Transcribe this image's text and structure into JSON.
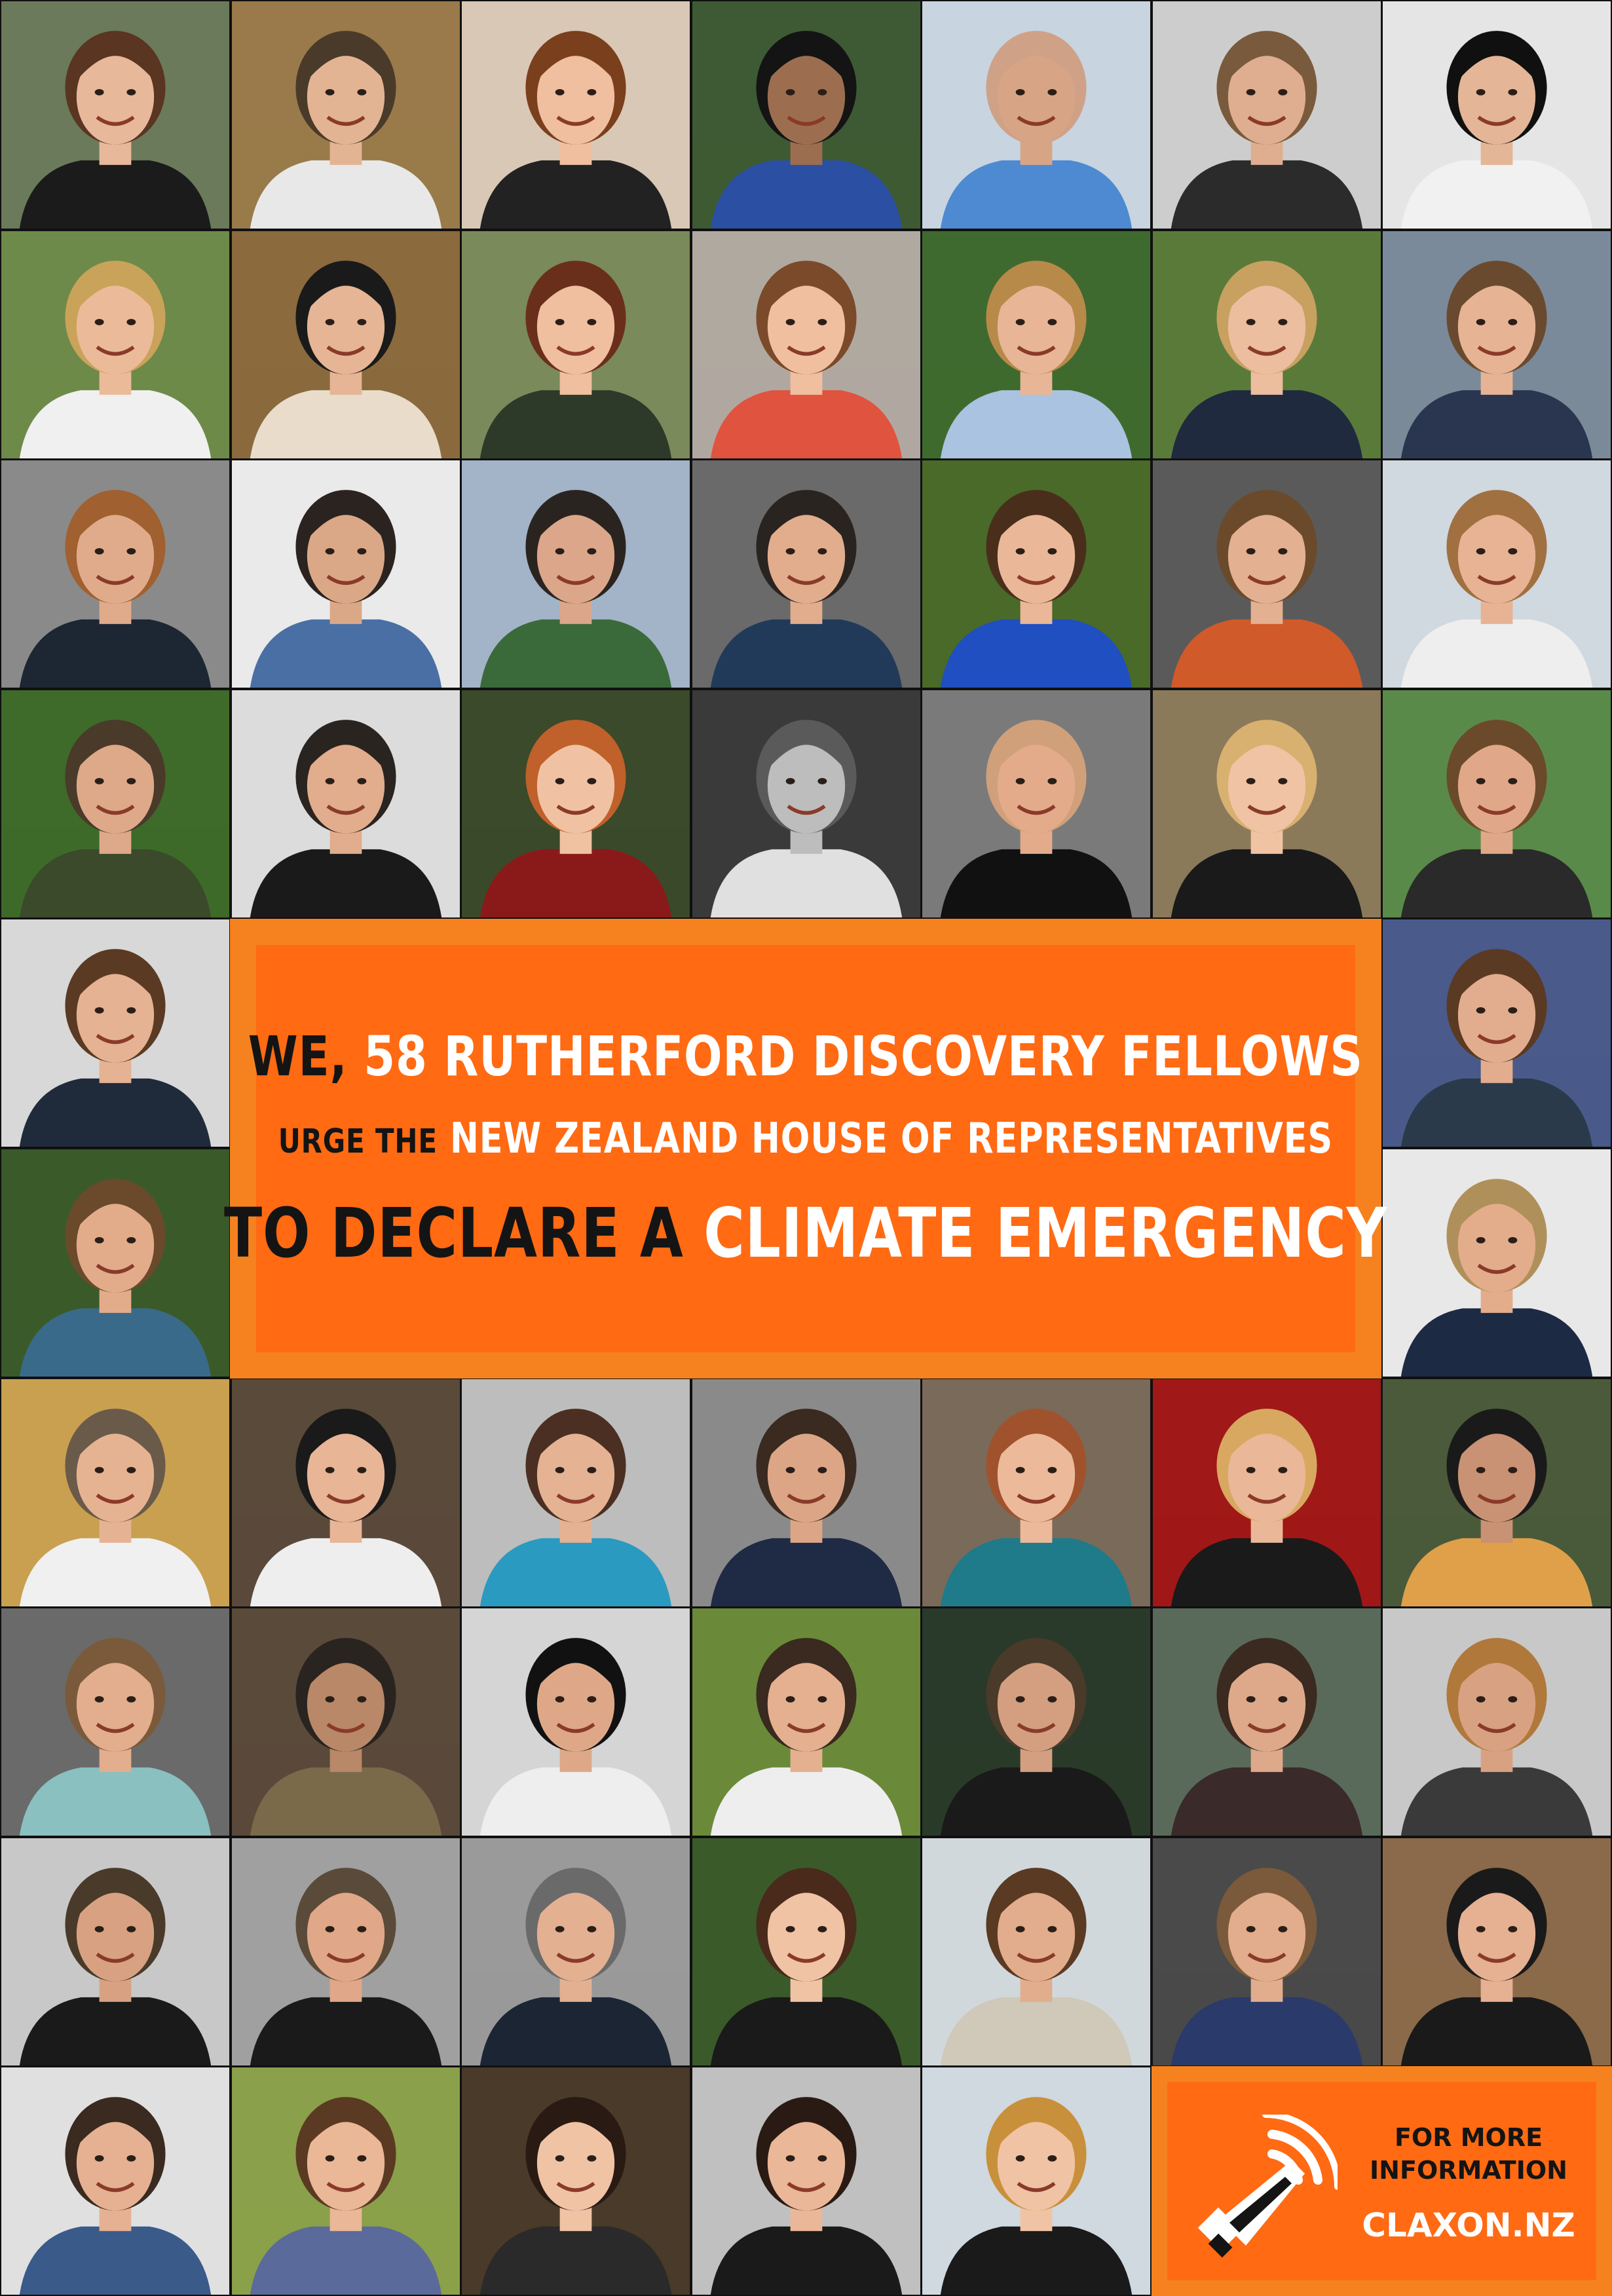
{
  "banner": {
    "line1": {
      "dark": "We,",
      "light": "58 Rutherford Discovery Fellows"
    },
    "line2": {
      "dark": "urge the",
      "light": "New Zealand House of Representatives"
    },
    "line3": {
      "dark": "to declare a",
      "light": "Climate Emergency"
    }
  },
  "info": {
    "line1": "FOR MORE",
    "line2": "INFORMATION",
    "url": "CLAXON.NZ",
    "icon": "megaphone-icon"
  },
  "portraits": [
    {
      "bg": "#6b7a5a",
      "skin": "#e8b89a",
      "hair": "#5a3522",
      "shirt": "#1b1b1b"
    },
    {
      "bg": "#9a7a4a",
      "skin": "#e3b493",
      "hair": "#4a3a2a",
      "shirt": "#e8e8e8"
    },
    {
      "bg": "#d9c8b5",
      "skin": "#efbf9f",
      "hair": "#7a3f1c",
      "shirt": "#222222"
    },
    {
      "bg": "#3e5a34",
      "skin": "#9c6e4f",
      "hair": "#141414",
      "shirt": "#2b4fa3"
    },
    {
      "bg": "#c8d4e0",
      "skin": "#d7a585",
      "hair": "#cfa287",
      "shirt": "#4d8ad1"
    },
    {
      "bg": "#cdcdcd",
      "skin": "#dfad8f",
      "hair": "#7a5a3c",
      "shirt": "#2b2b2b"
    },
    {
      "bg": "#e5e5e5",
      "skin": "#e4b596",
      "hair": "#101010",
      "shirt": "#f1f1f1"
    },
    {
      "bg": "#6e8a4a",
      "skin": "#ebbb99",
      "hair": "#c9a35a",
      "shirt": "#f0f0f0"
    },
    {
      "bg": "#8b6a3e",
      "skin": "#e6b595",
      "hair": "#1a1a1a",
      "shirt": "#e9dccb"
    },
    {
      "bg": "#7a8a5a",
      "skin": "#efbf9f",
      "hair": "#6a2f1a",
      "shirt": "#2d3a2a"
    },
    {
      "bg": "#b0a9a0",
      "skin": "#efbfa0",
      "hair": "#7a4a2a",
      "shirt": "#e0533f"
    },
    {
      "bg": "#3f6a2f",
      "skin": "#e8b696",
      "hair": "#b88a4a",
      "shirt": "#a9c3e0"
    },
    {
      "bg": "#5a7a3a",
      "skin": "#ecbd9e",
      "hair": "#c8a060",
      "shirt": "#1f2a3f"
    },
    {
      "bg": "#7a8a9a",
      "skin": "#e6b494",
      "hair": "#6a4a2f",
      "shirt": "#2a3550"
    },
    {
      "bg": "#8a8a8a",
      "skin": "#e0ab8b",
      "hair": "#a0602f",
      "shirt": "#1d2633"
    },
    {
      "bg": "#eaeaea",
      "skin": "#dba887",
      "hair": "#2a2320",
      "shirt": "#4a6fa5"
    },
    {
      "bg": "#a3b3c8",
      "skin": "#dca68a",
      "hair": "#2a2420",
      "shirt": "#3a6a3a"
    },
    {
      "bg": "#6a6a6a",
      "skin": "#e2ad8d",
      "hair": "#2a2420",
      "shirt": "#223a5a"
    },
    {
      "bg": "#4a6a2a",
      "skin": "#eab898",
      "hair": "#4a2e1c",
      "shirt": "#1f4fc0"
    },
    {
      "bg": "#5a5a5a",
      "skin": "#e3b091",
      "hair": "#6a4a2a",
      "shirt": "#d05a2a"
    },
    {
      "bg": "#d0d8e0",
      "skin": "#e7b394",
      "hair": "#a07040",
      "shirt": "#eeeeee"
    },
    {
      "bg": "#3e6a2a",
      "skin": "#dea989",
      "hair": "#4a3a2a",
      "shirt": "#3a4a2a"
    },
    {
      "bg": "#dcdcdc",
      "skin": "#e1ad8d",
      "hair": "#2a2420",
      "shirt": "#1a1a1a"
    },
    {
      "bg": "#3a4a2a",
      "skin": "#f0c2a3",
      "hair": "#c0602a",
      "shirt": "#8a1a1a"
    },
    {
      "bg": "#3a3a3a",
      "skin": "#bdbdbd",
      "hair": "#5a5a5a",
      "shirt": "#e0e0e0"
    },
    {
      "bg": "#7a7a7a",
      "skin": "#e4ab8b",
      "hair": "#d0a07a",
      "shirt": "#111111"
    },
    {
      "bg": "#8a7a5a",
      "skin": "#f0c3a4",
      "hair": "#d8b070",
      "shirt": "#1a1a1a"
    },
    {
      "bg": "#5a8a4a",
      "skin": "#e0a888",
      "hair": "#6a4a2a",
      "shirt": "#2a2a2a"
    },
    {
      "bg": "#d8d8d8",
      "skin": "#e5b293",
      "hair": "#5a3a22",
      "shirt": "#1f2a3a"
    },
    {
      "bg": "#4a5a8a",
      "skin": "#e2ad8e",
      "hair": "#5a3a22",
      "shirt": "#2a3a4a"
    },
    {
      "bg": "#3a5a2a",
      "skin": "#e2ac8b",
      "hair": "#6a4a2a",
      "shirt": "#3a6a8a"
    },
    {
      "bg": "#e8e8e8",
      "skin": "#e3ad8c",
      "hair": "#b0905a",
      "shirt": "#1c2a44"
    },
    {
      "bg": "#c8a050",
      "skin": "#e6b392",
      "hair": "#6a5a4a",
      "shirt": "#f0f0f0"
    },
    {
      "bg": "#5a4a3a",
      "skin": "#e8b597",
      "hair": "#1a1a1a",
      "shirt": "#eeeeee"
    },
    {
      "bg": "#bdbdbd",
      "skin": "#e5b293",
      "hair": "#4a2f22",
      "shirt": "#2a9ac0"
    },
    {
      "bg": "#8a8a8a",
      "skin": "#dca686",
      "hair": "#3a2a20",
      "shirt": "#1f2a44"
    },
    {
      "bg": "#7a6a5a",
      "skin": "#ecba9a",
      "hair": "#a0522d",
      "shirt": "#1f7a8a"
    },
    {
      "bg": "#a01818",
      "skin": "#eab898",
      "hair": "#d8a860",
      "shirt": "#1a1a1a"
    },
    {
      "bg": "#4a5a3a",
      "skin": "#c99274",
      "hair": "#1a1a1a",
      "shirt": "#e0a04a"
    },
    {
      "bg": "#6a6a6a",
      "skin": "#e2ae8e",
      "hair": "#7a5a3a",
      "shirt": "#8ac0c0"
    },
    {
      "bg": "#5a4a3a",
      "skin": "#b88868",
      "hair": "#2a2420",
      "shirt": "#7a6a4a"
    },
    {
      "bg": "#d5d5d5",
      "skin": "#dea888",
      "hair": "#111111",
      "shirt": "#eeeeee"
    },
    {
      "bg": "#6a8a3a",
      "skin": "#e4b090",
      "hair": "#3a2a20",
      "shirt": "#eeeeee"
    },
    {
      "bg": "#2a3a2a",
      "skin": "#d49f80",
      "hair": "#4a3a2a",
      "shirt": "#1a1a1a"
    },
    {
      "bg": "#5a6a5a",
      "skin": "#dea98a",
      "hair": "#3a2a20",
      "shirt": "#3a2a2a"
    },
    {
      "bg": "#c8c8c8",
      "skin": "#d8a282",
      "hair": "#b0783a",
      "shirt": "#3a3a3a"
    },
    {
      "bg": "#c8c8c8",
      "skin": "#d8a282",
      "hair": "#4a3a2a",
      "shirt": "#1a1a1a"
    },
    {
      "bg": "#a0a0a0",
      "skin": "#e0a888",
      "hair": "#5a4a3a",
      "shirt": "#1a1a1a"
    },
    {
      "bg": "#9a9a9a",
      "skin": "#e4b092",
      "hair": "#6a6a6a",
      "shirt": "#1c2533"
    },
    {
      "bg": "#3a5a2a",
      "skin": "#f0c3a5",
      "hair": "#4a2a1a",
      "shirt": "#1a1a1a"
    },
    {
      "bg": "#d0d8dc",
      "skin": "#e2ad8d",
      "hair": "#5a3a22",
      "shirt": "#d0c8b8"
    },
    {
      "bg": "#4a4a4a",
      "skin": "#e2ad8d",
      "hair": "#7a5a3a",
      "shirt": "#2a3a6a"
    },
    {
      "bg": "#8a6a4a",
      "skin": "#e6b092",
      "hair": "#1a1a1a",
      "shirt": "#1a1a1a"
    },
    {
      "bg": "#e0e0e0",
      "skin": "#e5b192",
      "hair": "#3a2a20",
      "shirt": "#3a5a8a"
    },
    {
      "bg": "#8aa04a",
      "skin": "#eab797",
      "hair": "#5a3a22",
      "shirt": "#5a6a9a"
    },
    {
      "bg": "#4a3a2a",
      "skin": "#f0c3a5",
      "hair": "#2a1a14",
      "shirt": "#2a2a2a"
    },
    {
      "bg": "#c0c0c0",
      "skin": "#eab798",
      "hair": "#2a1a14",
      "shirt": "#1a1a1a"
    },
    {
      "bg": "#d0d8e0",
      "skin": "#f0c3a5",
      "hair": "#c8903a",
      "shirt": "#1a1a1a"
    }
  ]
}
